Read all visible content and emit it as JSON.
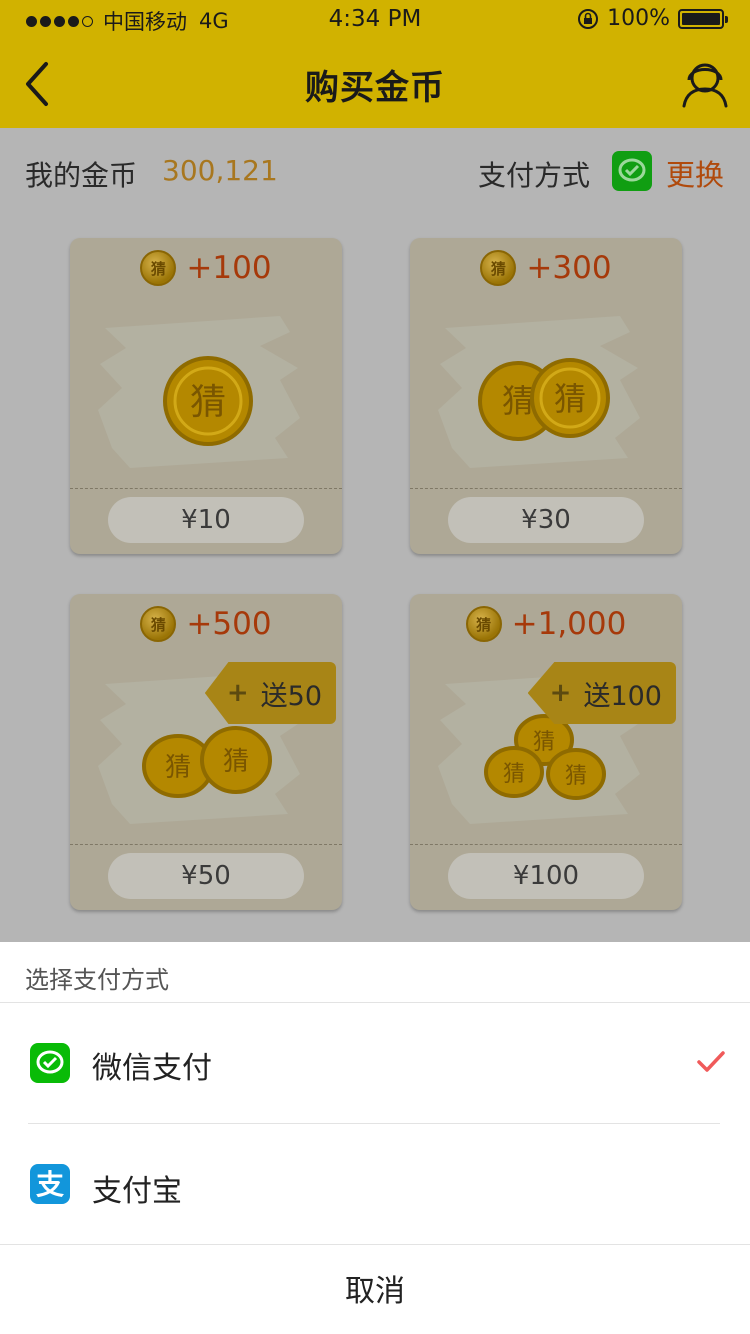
{
  "status_bar": {
    "carrier": "中国移动",
    "network": "4G",
    "time": "4:34 PM",
    "battery": "100%"
  },
  "nav": {
    "title": "购买金币",
    "back_icon": "chevron-left-icon",
    "service_icon": "customer-service-icon"
  },
  "coins": {
    "label": "我的金币",
    "value": "300,121",
    "pay_label": "支付方式",
    "pay_icon": "wechat-pay-icon",
    "change_label": "更换"
  },
  "packages": [
    {
      "amount": "+100",
      "price": "¥10",
      "bonus": ""
    },
    {
      "amount": "+300",
      "price": "¥30",
      "bonus": ""
    },
    {
      "amount": "+500",
      "price": "¥50",
      "bonus": "送50"
    },
    {
      "amount": "+1,000",
      "price": "¥100",
      "bonus": "送100"
    }
  ],
  "coin_char": "猜",
  "sheet": {
    "title": "选择支付方式",
    "options": [
      {
        "label": "微信支付",
        "icon": "wechat-pay-icon",
        "selected": true
      },
      {
        "label": "支付宝",
        "icon": "alipay-icon",
        "selected": false
      }
    ],
    "cancel": "取消"
  },
  "colors": {
    "header": "#d1b200",
    "accent_orange": "#b04a0c",
    "wechat_green": "#09bb07",
    "alipay_blue": "#1296db",
    "check_red": "#f05a5a"
  }
}
